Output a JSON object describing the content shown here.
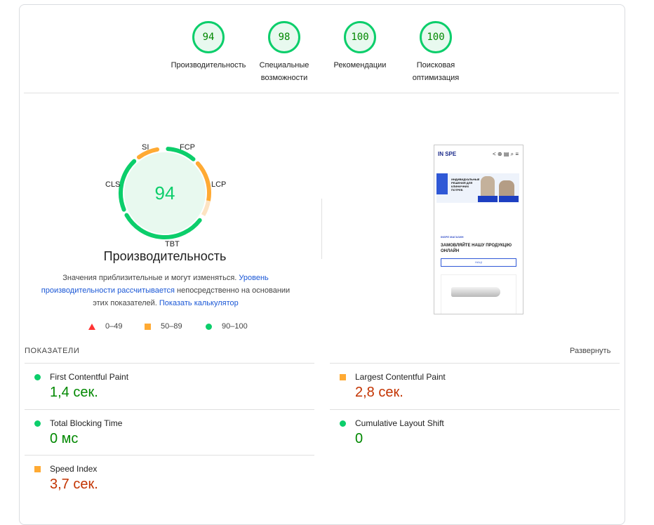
{
  "colors": {
    "pass": "#0cce6b",
    "pass_text": "#008800",
    "average": "#ffaa33",
    "average_text": "#c33300",
    "fail": "#ff3333",
    "link": "#1a57d6"
  },
  "gauges": [
    {
      "score": "94",
      "label": "Производительность"
    },
    {
      "score": "98",
      "label": "Специальные возможности"
    },
    {
      "score": "100",
      "label": "Рекомендации"
    },
    {
      "score": "100",
      "label": "Поисковая оптимизация"
    }
  ],
  "performance": {
    "score": 94,
    "score_text": "94",
    "title": "Производительность",
    "metric_tags": [
      "SI",
      "FCP",
      "LCP",
      "TBT",
      "CLS"
    ],
    "desc_1": "Значения приблизительные и могут изменяться. ",
    "desc_link_1": "Уровень производительности рассчитывается",
    "desc_2": " непосредственно на основании этих показателей. ",
    "desc_link_2": "Показать калькулятор"
  },
  "legend": [
    {
      "shape": "triangle-icon",
      "range": "0–49"
    },
    {
      "shape": "square-icon",
      "range": "50–89"
    },
    {
      "shape": "circle-icon",
      "range": "90–100"
    }
  ],
  "metrics": {
    "section_title": "ПОКАЗАТЕЛИ",
    "expand_label": "Развернуть",
    "items": [
      {
        "title": "First Contentful Paint",
        "value": "1,4 сек.",
        "status": "pass"
      },
      {
        "title": "Largest Contentful Paint",
        "value": "2,8 сек.",
        "status": "average"
      },
      {
        "title": "Total Blocking Time",
        "value": "0 мс",
        "status": "pass"
      },
      {
        "title": "Cumulative Layout Shift",
        "value": "0",
        "status": "pass"
      },
      {
        "title": "Speed Index",
        "value": "3,7 сек.",
        "status": "average"
      }
    ]
  },
  "thumbnail": {
    "logo": "IN SPE",
    "toolbar": "< ⊕ ▤ ⌕ ≡",
    "hero_title": "ИНДИВИДУАЛЬНЫЕ РЕШЕНИЯ ДЛЯ КЛИНИЧНИХ ПОТРЕБ",
    "shop_label": "INSPE МАГАЗИН",
    "order_text": "ЗАМОВЛЯЙТЕ НАШУ ПРОДУКЦІЮ ОНЛАЙН",
    "select_text": "НАЦІ"
  }
}
